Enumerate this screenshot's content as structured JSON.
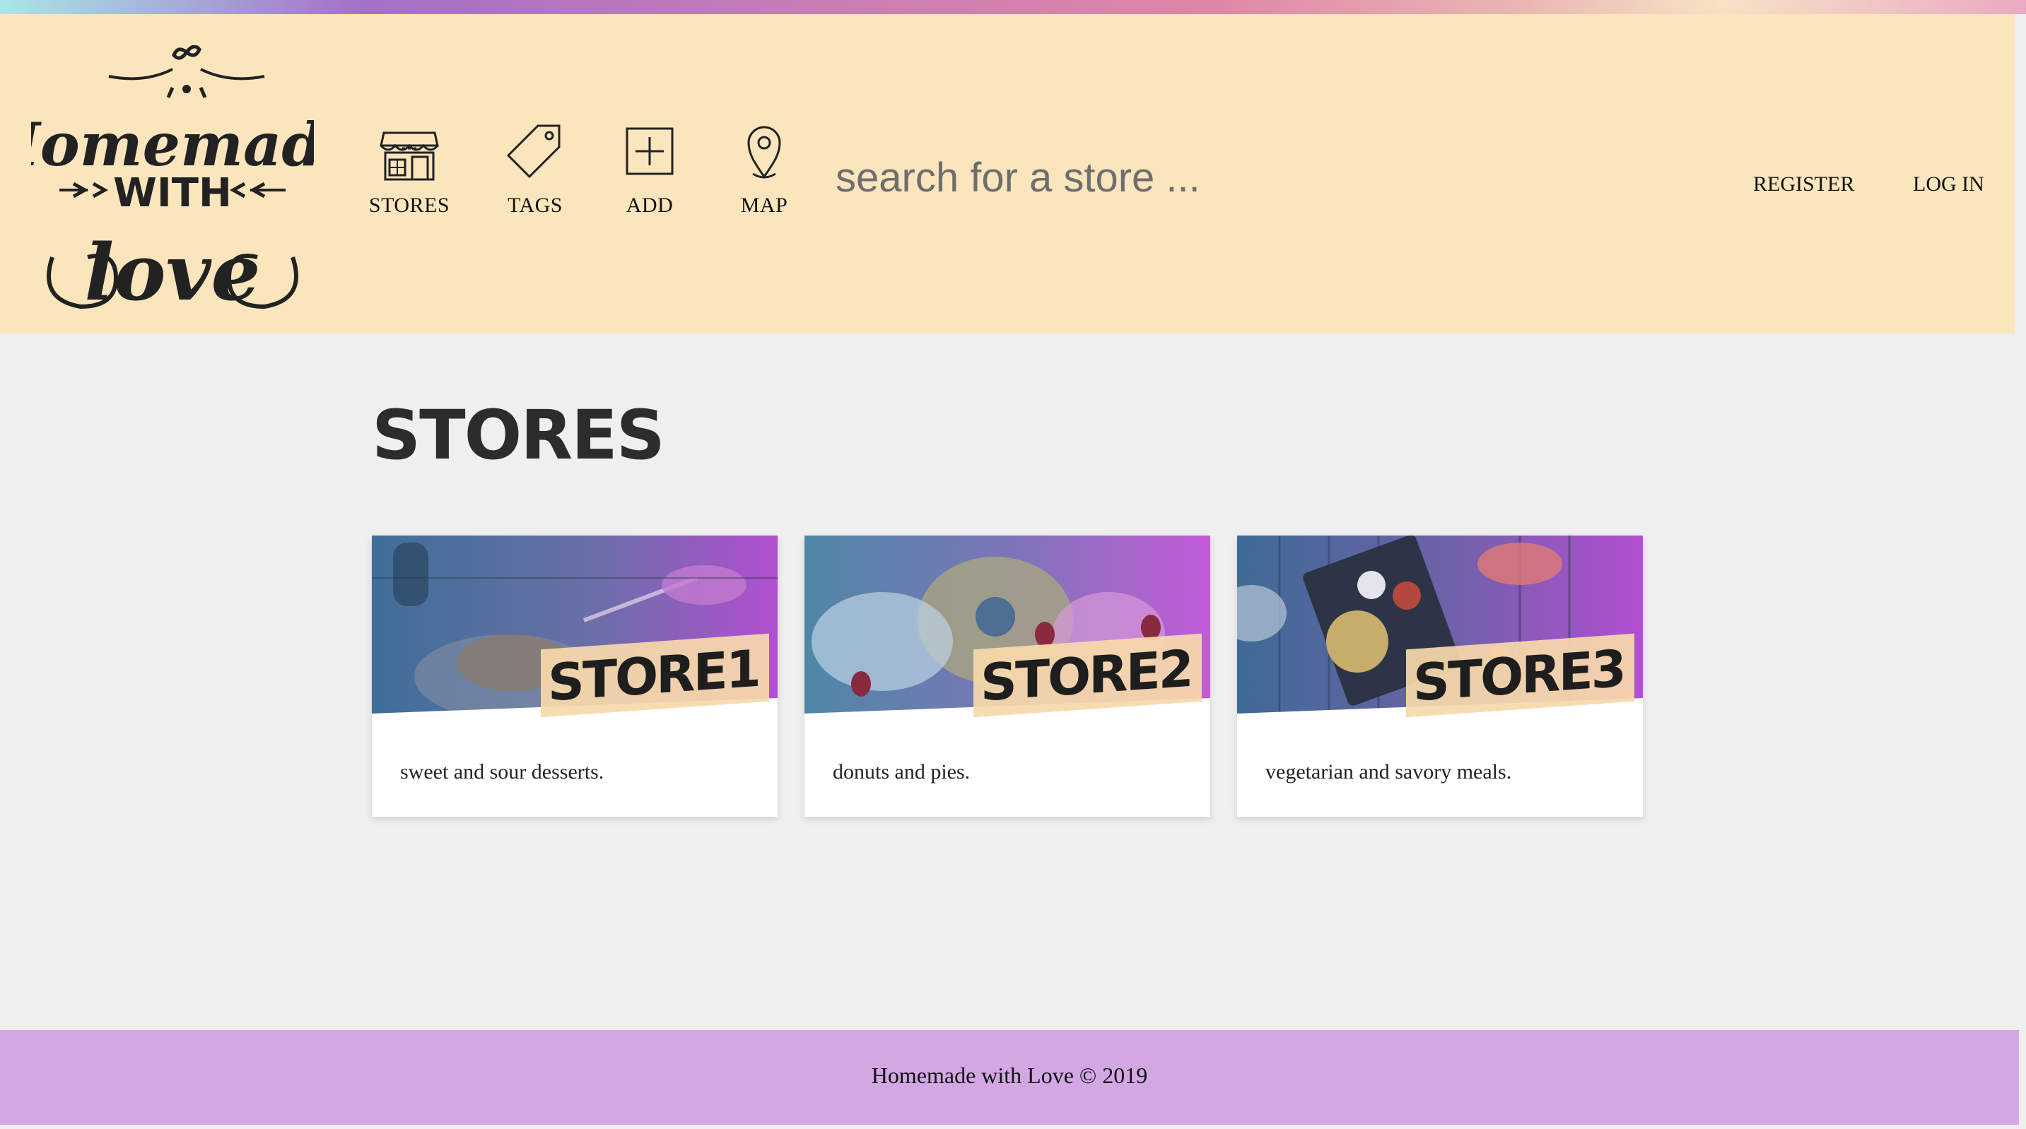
{
  "brand": {
    "logo_line1": "Homemade",
    "logo_line2": "WITH",
    "logo_line3": "love"
  },
  "nav": {
    "items": [
      {
        "label": "STORES",
        "icon": "storefront-icon"
      },
      {
        "label": "TAGS",
        "icon": "tag-icon"
      },
      {
        "label": "ADD",
        "icon": "plus-square-icon"
      },
      {
        "label": "MAP",
        "icon": "map-pin-icon"
      }
    ]
  },
  "search": {
    "placeholder": "search for a store ..."
  },
  "auth": {
    "register": "REGISTER",
    "login": "LOG IN"
  },
  "page": {
    "title": "STORES"
  },
  "stores": [
    {
      "name": "STORE1",
      "description": "sweet and sour desserts."
    },
    {
      "name": "STORE2",
      "description": "donuts and pies."
    },
    {
      "name": "STORE3",
      "description": "vegetarian and savory meals."
    }
  ],
  "footer": {
    "text": "Homemade with Love © 2019"
  },
  "colors": {
    "header_bg": "#fbe5bc",
    "page_bg": "#efefef",
    "footer_bg": "#d3a6e4",
    "tag_bg": "#f7d9aa"
  }
}
